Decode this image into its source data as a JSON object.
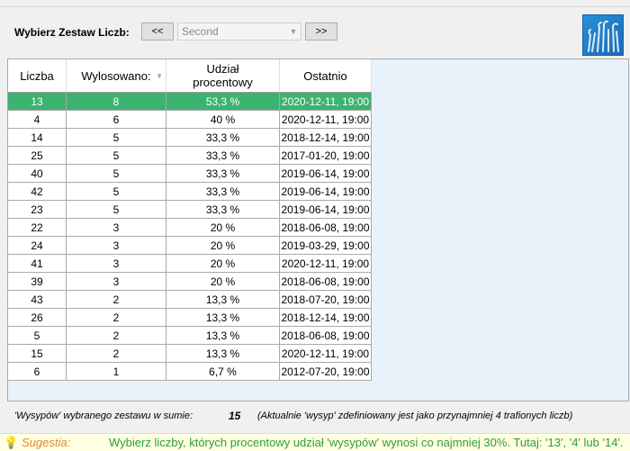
{
  "toolbar": {
    "label": "Wybierz Zestaw Liczb:",
    "prev_label": "<<",
    "next_label": ">>",
    "set_value": "Second"
  },
  "table": {
    "columns": [
      "Liczba",
      "Wylosowano:",
      "Udział procentowy",
      "Ostatnio"
    ],
    "rows": [
      {
        "liczba": "13",
        "wylosowano": "8",
        "udzial": "53,3 %",
        "ostatnio": "2020-12-11,  19:00",
        "selected": true
      },
      {
        "liczba": "4",
        "wylosowano": "6",
        "udzial": "40 %",
        "ostatnio": "2020-12-11,  19:00"
      },
      {
        "liczba": "14",
        "wylosowano": "5",
        "udzial": "33,3 %",
        "ostatnio": "2018-12-14,  19:00"
      },
      {
        "liczba": "25",
        "wylosowano": "5",
        "udzial": "33,3 %",
        "ostatnio": "2017-01-20,  19:00"
      },
      {
        "liczba": "40",
        "wylosowano": "5",
        "udzial": "33,3 %",
        "ostatnio": "2019-06-14,  19:00"
      },
      {
        "liczba": "42",
        "wylosowano": "5",
        "udzial": "33,3 %",
        "ostatnio": "2019-06-14,  19:00"
      },
      {
        "liczba": "23",
        "wylosowano": "5",
        "udzial": "33,3 %",
        "ostatnio": "2019-06-14,  19:00"
      },
      {
        "liczba": "22",
        "wylosowano": "3",
        "udzial": "20 %",
        "ostatnio": "2018-06-08,  19:00"
      },
      {
        "liczba": "24",
        "wylosowano": "3",
        "udzial": "20 %",
        "ostatnio": "2019-03-29,  19:00"
      },
      {
        "liczba": "41",
        "wylosowano": "3",
        "udzial": "20 %",
        "ostatnio": "2020-12-11,  19:00"
      },
      {
        "liczba": "39",
        "wylosowano": "3",
        "udzial": "20 %",
        "ostatnio": "2018-06-08,  19:00"
      },
      {
        "liczba": "43",
        "wylosowano": "2",
        "udzial": "13,3 %",
        "ostatnio": "2018-07-20,  19:00"
      },
      {
        "liczba": "26",
        "wylosowano": "2",
        "udzial": "13,3 %",
        "ostatnio": "2018-12-14,  19:00"
      },
      {
        "liczba": "5",
        "wylosowano": "2",
        "udzial": "13,3 %",
        "ostatnio": "2018-06-08,  19:00"
      },
      {
        "liczba": "15",
        "wylosowano": "2",
        "udzial": "13,3 %",
        "ostatnio": "2020-12-11,  19:00"
      },
      {
        "liczba": "6",
        "wylosowano": "1",
        "udzial": "6,7 %",
        "ostatnio": "2012-07-20,  19:00"
      }
    ]
  },
  "summary": {
    "label": "'Wysypów' wybranego zestawu w sumie:",
    "count": "15",
    "note": "(Aktualnie 'wysyp' zdefiniowany jest jako przynajmniej 4 trafionych liczb)"
  },
  "hint": {
    "label": "Sugestia:",
    "text": "Wybierz liczby, których procentowy udział 'wysypów' wynosi co najmniej 30%. Tutaj: '13', '4' lub '14'."
  },
  "colors": {
    "selected_row": "#3cb371",
    "hint_text": "#2e9c3e",
    "hint_label": "#e8842a",
    "hint_background": "#ffffe1"
  }
}
